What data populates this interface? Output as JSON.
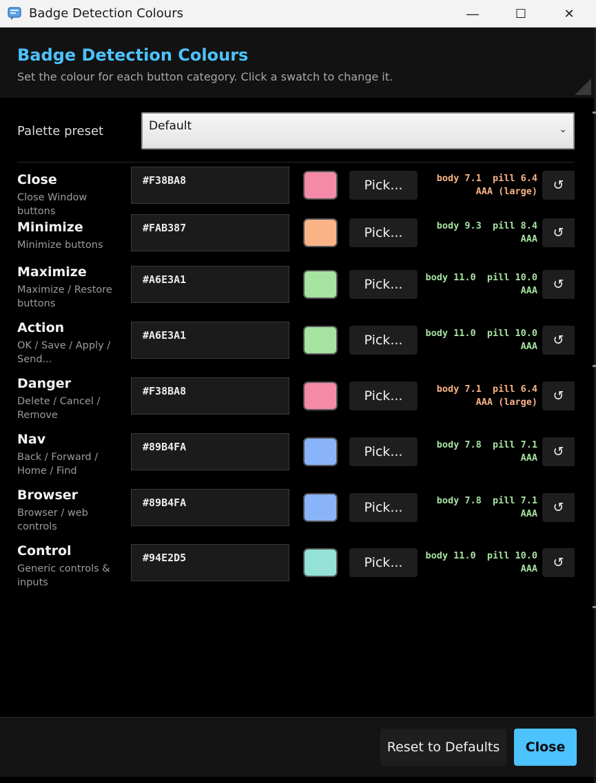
{
  "window": {
    "title": "Badge Detection Colours",
    "min_glyph": "—",
    "max_glyph": "☐",
    "close_glyph": "✕"
  },
  "header": {
    "title": "Badge Detection Colours",
    "subtitle": "Set the colour for each button category. Click a swatch to change it."
  },
  "preset": {
    "label": "Palette preset",
    "value": "Default"
  },
  "pick_label": "Pick...",
  "reset_glyph": "↺",
  "categories": [
    {
      "name": "Close",
      "desc": "Close Window buttons",
      "hex": "#F38BA8",
      "color": "#F38BA8",
      "contrast_line1": "body 7.1  pill 6.4",
      "contrast_line2": "AAA (large)",
      "contrast_color": "#FAB387"
    },
    {
      "name": "Minimize",
      "desc": "Minimize buttons",
      "hex": "#FAB387",
      "color": "#FAB387",
      "contrast_line1": "body 9.3  pill 8.4",
      "contrast_line2": "AAA",
      "contrast_color": "#A6E3A1"
    },
    {
      "name": "Maximize",
      "desc": "Maximize / Restore buttons",
      "hex": "#A6E3A1",
      "color": "#A6E3A1",
      "contrast_line1": "body 11.0  pill 10.0",
      "contrast_line2": "AAA",
      "contrast_color": "#A6E3A1"
    },
    {
      "name": "Action",
      "desc": "OK / Save / Apply / Send...",
      "hex": "#A6E3A1",
      "color": "#A6E3A1",
      "contrast_line1": "body 11.0  pill 10.0",
      "contrast_line2": "AAA",
      "contrast_color": "#A6E3A1"
    },
    {
      "name": "Danger",
      "desc": "Delete / Cancel / Remove",
      "hex": "#F38BA8",
      "color": "#F38BA8",
      "contrast_line1": "body 7.1  pill 6.4",
      "contrast_line2": "AAA (large)",
      "contrast_color": "#FAB387"
    },
    {
      "name": "Nav",
      "desc": "Back / Forward / Home / Find",
      "hex": "#89B4FA",
      "color": "#89B4FA",
      "contrast_line1": "body 7.8  pill 7.1",
      "contrast_line2": "AAA",
      "contrast_color": "#A6E3A1"
    },
    {
      "name": "Browser",
      "desc": "Browser / web controls",
      "hex": "#89B4FA",
      "color": "#89B4FA",
      "contrast_line1": "body 7.8  pill 7.1",
      "contrast_line2": "AAA",
      "contrast_color": "#A6E3A1"
    },
    {
      "name": "Control",
      "desc": "Generic controls & inputs",
      "hex": "#94E2D5",
      "color": "#94E2D5",
      "contrast_line1": "body 11.0  pill 10.0",
      "contrast_line2": "AAA",
      "contrast_color": "#A6E3A1"
    }
  ],
  "footer": {
    "reset_label": "Reset to Defaults",
    "close_label": "Close"
  },
  "colors": {
    "accent": "#4cc2ff"
  }
}
